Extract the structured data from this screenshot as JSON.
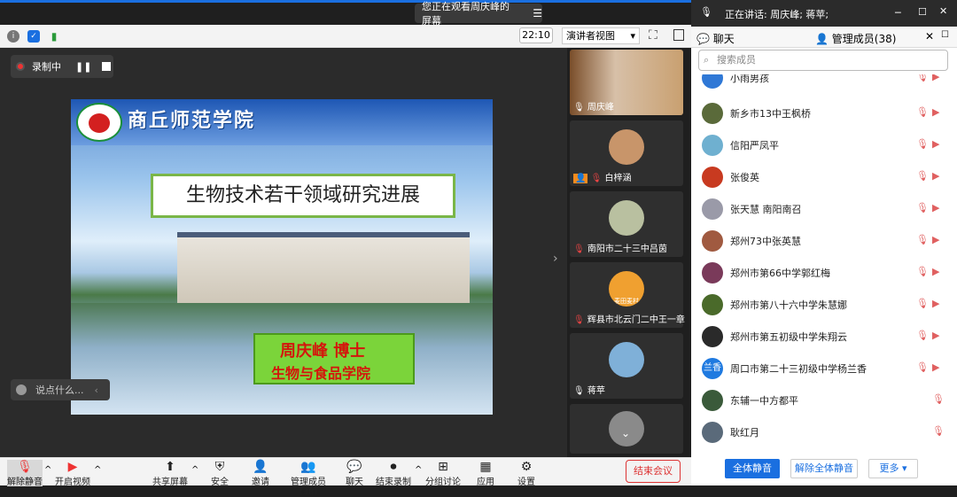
{
  "topbar": {
    "share_status": "您正在观看周庆峰的屏幕",
    "menu_icon": "menu-icon",
    "time": "22:10",
    "view_label": "演讲者视图"
  },
  "recording": {
    "label": "录制中"
  },
  "slide": {
    "school": "商丘师范学院",
    "title": "生物技术若干领域研究进展",
    "presenter": "周庆峰  博士",
    "department": "生物与食品学院"
  },
  "chat_prompt": "说点什么...",
  "thumbnails": [
    {
      "name": "周庆峰"
    },
    {
      "name": "白梓涵"
    },
    {
      "name": "南阳市二十三中吕茵"
    },
    {
      "name": "辉县市北云门二中王一章"
    },
    {
      "name": "蒋苹"
    },
    {
      "name": ""
    }
  ],
  "thumb_badge": "麦田麦村",
  "right_panel": {
    "speaking": "正在讲话: 周庆峰; 蒋苹;",
    "tab_chat": "聊天",
    "tab_members": "管理成员(38)",
    "search_placeholder": "搜索成员",
    "members": [
      {
        "name": "小雨男孩"
      },
      {
        "name": "新乡市13中王枫桥"
      },
      {
        "name": "信阳严凤平"
      },
      {
        "name": "张俊英"
      },
      {
        "name": "张天慧  南阳南召"
      },
      {
        "name": "郑州73中张英慧"
      },
      {
        "name": "郑州市第66中学郭红梅"
      },
      {
        "name": "郑州市第八十六中学朱慧娜"
      },
      {
        "name": "郑州市第五初级中学朱翔云"
      },
      {
        "name": "周口市第二十三初级中学杨兰香"
      },
      {
        "name": "东辅一中方都平"
      },
      {
        "name": "耿红月"
      }
    ],
    "avatar_text_10": "兰香",
    "btn_mute_all": "全体静音",
    "btn_unmute_all": "解除全体静音",
    "btn_more": "更多 ▾"
  },
  "bottom": {
    "unmute": "解除静音",
    "start_video": "开启视频",
    "share": "共享屏幕",
    "security": "安全",
    "invite": "邀请",
    "members": "管理成员(38)",
    "chat": "聊天",
    "record": "结束录制",
    "breakout": "分组讨论",
    "apps": "应用",
    "settings": "设置",
    "end": "结束会议"
  }
}
